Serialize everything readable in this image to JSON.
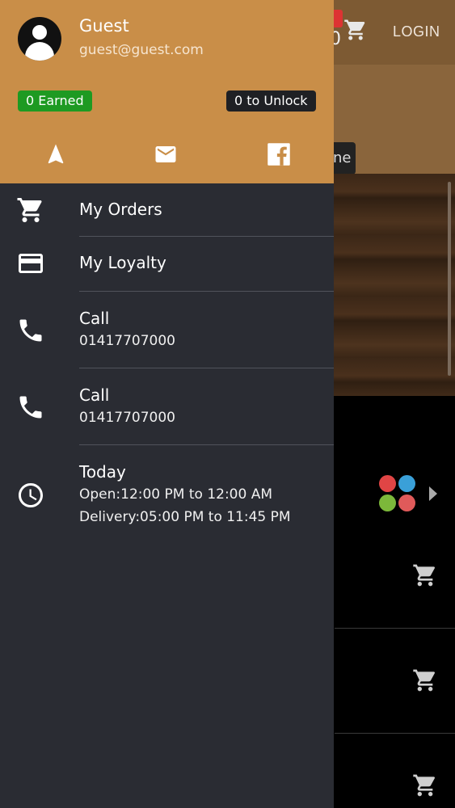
{
  "background": {
    "cart_count": "0",
    "login_label": "LOGIN",
    "pill_text": "ne"
  },
  "drawer": {
    "user_name": "Guest",
    "user_email": "guest@guest.com",
    "earned_label": "0 Earned",
    "unlock_label": "0 to Unlock",
    "header_icons": [
      "navigation-icon",
      "mail-icon",
      "facebook-icon"
    ],
    "items": [
      {
        "icon": "cart-icon",
        "title": "My Orders"
      },
      {
        "icon": "card-icon",
        "title": "My Loyalty"
      },
      {
        "icon": "phone-icon",
        "title": "Call",
        "subtitle": "01417707000"
      },
      {
        "icon": "phone-icon",
        "title": "Call",
        "subtitle": "01417707000"
      },
      {
        "icon": "clock-icon",
        "title": "Today",
        "subtitle": "Open:12:00 PM to 12:00 AM",
        "subtitle2": "Delivery:05:00 PM to 11:45 PM"
      }
    ]
  },
  "colors": {
    "header_bg": "#c98e48",
    "drawer_bg": "#2a2c33",
    "earned_badge": "#1e9a22",
    "unlock_badge": "#1f2024"
  }
}
